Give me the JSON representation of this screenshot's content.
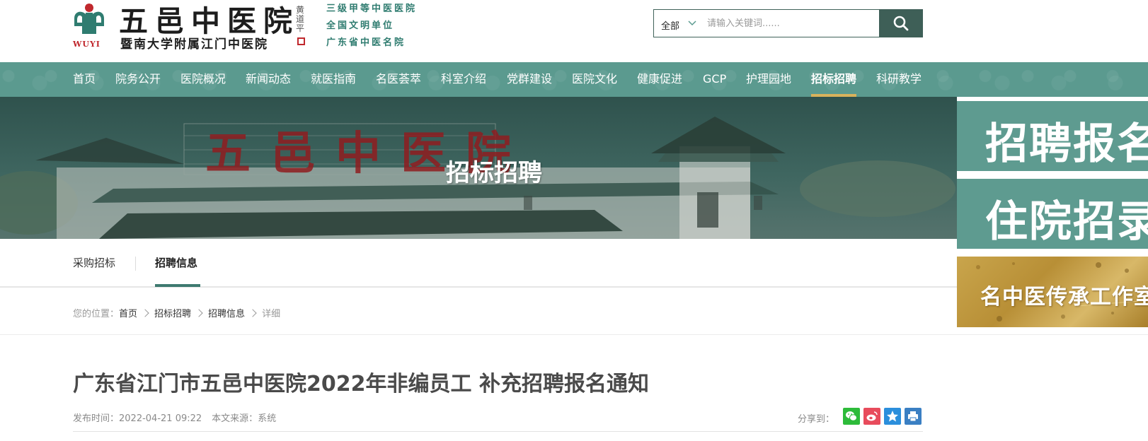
{
  "header": {
    "logo_mark_text": "WUYI",
    "title": "五邑中医院",
    "subtitle": "暨南大学附属江门中医院",
    "calligraphy": "黄道平",
    "honors": [
      "三级甲等中医医院",
      "全国文明单位",
      "广东省中医名院"
    ]
  },
  "search": {
    "scope": "全部",
    "placeholder": "请输入关键词......",
    "value": ""
  },
  "nav": {
    "items": [
      "首页",
      "院务公开",
      "医院概况",
      "新闻动态",
      "就医指南",
      "名医荟萃",
      "科室介绍",
      "党群建设",
      "医院文化",
      "健康促进",
      "GCP",
      "护理园地",
      "招标招聘",
      "科研教学"
    ],
    "active_index": 12
  },
  "banner": {
    "title": "招标招聘",
    "sign_text": "五邑中医院"
  },
  "side_panels": [
    "招聘报名",
    "住院招录",
    "名中医传承工作室"
  ],
  "subtabs": {
    "items": [
      "采购招标",
      "招聘信息"
    ],
    "active_index": 1
  },
  "breadcrumb": {
    "prefix": "您的位置：",
    "items": [
      "首页",
      "招标招聘",
      "招聘信息",
      "详细"
    ]
  },
  "article": {
    "title": "广东省江门市五邑中医院2022年非编员工 补充招聘报名通知",
    "publish_label": "发布时间：",
    "publish_time": "2022-04-21 09:22",
    "source_label": "本文来源：",
    "source": "系统",
    "share_label": "分享到："
  },
  "share_buttons": [
    {
      "name": "wechat",
      "color": "#2dbb3a"
    },
    {
      "name": "weibo",
      "color": "#e84b5c"
    },
    {
      "name": "qzone",
      "color": "#2b8fdc"
    },
    {
      "name": "print",
      "color": "#3a7fc3"
    }
  ],
  "colors": {
    "nav_bg": "#5b9a8f",
    "nav_active_underline": "#d8b25c",
    "brand_green": "#2f7c70",
    "search_button": "#3e5f57",
    "logo_red": "#c0282d"
  }
}
